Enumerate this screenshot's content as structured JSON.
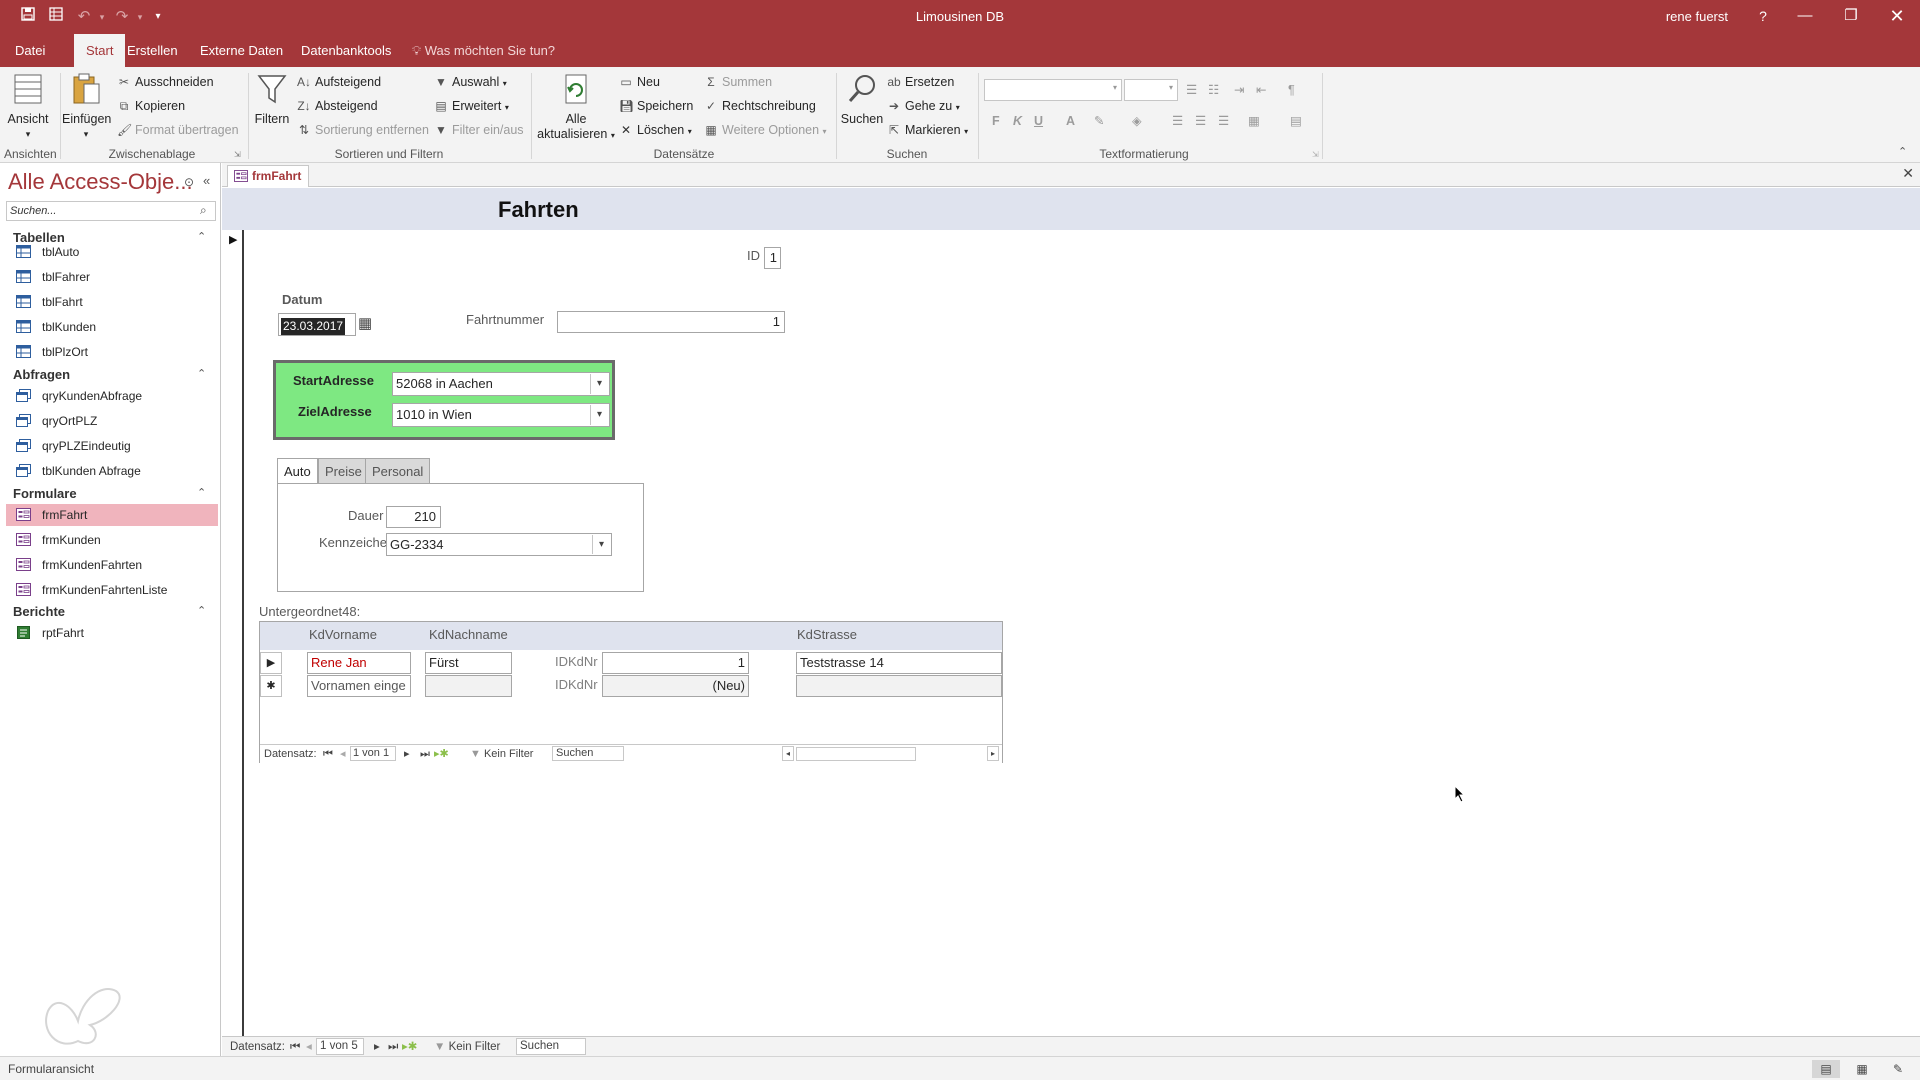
{
  "app": {
    "title": "Limousinen DB",
    "user": "rene fuerst",
    "help_glyph": "?"
  },
  "tabs": [
    {
      "label": "Datei"
    },
    {
      "label": "Start"
    },
    {
      "label": "Erstellen"
    },
    {
      "label": "Externe Daten"
    },
    {
      "label": "Datenbanktools"
    }
  ],
  "tellme": "Was möchten Sie tun?",
  "ribbon": {
    "ansicht": "Ansicht",
    "einfuegen": "Einfügen",
    "ausschneiden": "Ausschneiden",
    "kopieren": "Kopieren",
    "format": "Format übertragen",
    "filtern": "Filtern",
    "aufsteigend": "Aufsteigend",
    "absteigend": "Absteigend",
    "sortierung": "Sortierung entfernen",
    "auswahl": "Auswahl",
    "erweitert": "Erweitert",
    "filter_einaus": "Filter ein/aus",
    "alle_1": "Alle",
    "alle_2": "aktualisieren",
    "neu": "Neu",
    "speichern": "Speichern",
    "loeschen": "Löschen",
    "summen": "Summen",
    "rechtschreibung": "Rechtschreibung",
    "weitere": "Weitere Optionen",
    "suchen": "Suchen",
    "ersetzen": "Ersetzen",
    "gehe_zu": "Gehe zu",
    "markieren": "Markieren",
    "fmt_bold": "F",
    "fmt_italic": "K",
    "fmt_underline": "U",
    "fmt_fontcolor": "A",
    "groups": {
      "ansichten": "Ansichten",
      "zwischenablage": "Zwischenablage",
      "sortieren": "Sortieren und Filtern",
      "datensaetze": "Datensätze",
      "suchen": "Suchen",
      "textformatierung": "Textformatierung"
    }
  },
  "nav": {
    "title": "Alle Access-Obje...",
    "search_placeholder": "Suchen...",
    "groups": [
      {
        "name": "Tabellen",
        "items": [
          "tblAuto",
          "tblFahrer",
          "tblFahrt",
          "tblKunden",
          "tblPlzOrt"
        ]
      },
      {
        "name": "Abfragen",
        "items": [
          "qryKundenAbfrage",
          "qryOrtPLZ",
          "qryPLZEindeutig",
          "tblKunden Abfrage"
        ]
      },
      {
        "name": "Formulare",
        "items": [
          "frmFahrt",
          "frmKunden",
          "frmKundenFahrten",
          "frmKundenFahrtenListe"
        ]
      },
      {
        "name": "Berichte",
        "items": [
          "rptFahrt"
        ]
      }
    ],
    "selected": "frmFahrt"
  },
  "document": {
    "tab": "frmFahrt"
  },
  "form": {
    "title": "Fahrten",
    "id_label": "ID",
    "id_value": "1",
    "datum_label": "Datum",
    "datum_value": "23.03.2017",
    "fahrtnummer_label": "Fahrtnummer",
    "fahrtnummer_value": "1",
    "start_label": "StartAdresse",
    "start_value": "52068 in Aachen",
    "ziel_label": "ZielAdresse",
    "ziel_value": "1010 in Wien",
    "tabs": [
      "Auto",
      "Preise",
      "Personal"
    ],
    "dauer_label": "Dauer",
    "dauer_value": "210",
    "kennzeichen_label": "Kennzeichen",
    "kennzeichen_value": "GG-2334",
    "subform_label": "Untergeordnet48:",
    "accent_green": "#7ee882"
  },
  "subform": {
    "headers": {
      "vorname": "KdVorname",
      "nachname": "KdNachname",
      "strasse": "KdStrasse"
    },
    "row1": {
      "vorname": "Rene Jan",
      "nachname": "Fürst",
      "idk_label": "IDKdNr",
      "idk_value": "1",
      "strasse": "Teststrasse 14"
    },
    "row2": {
      "vorname": "Vornamen einge",
      "idk_label": "IDKdNr",
      "idk_value": "(Neu)"
    },
    "nav": {
      "label": "Datensatz:",
      "position": "1 von 1",
      "filter": "Kein Filter",
      "search": "Suchen"
    }
  },
  "recnav": {
    "label": "Datensatz:",
    "position": "1 von 5",
    "filter": "Kein Filter",
    "search": "Suchen"
  },
  "status": {
    "text": "Formularansicht"
  },
  "colors": {
    "brand": "#a4373a",
    "selected_nav": "#f0b4bd",
    "header_band": "#dfe3ee"
  }
}
